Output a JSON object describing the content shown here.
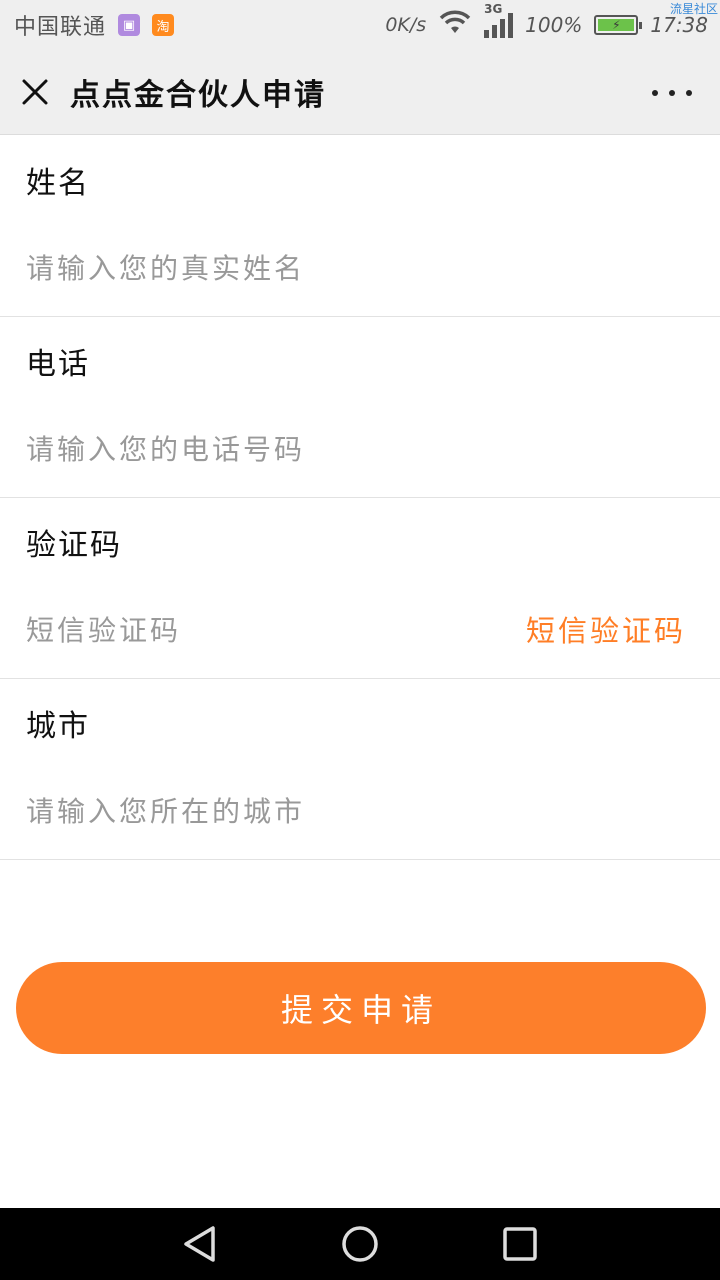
{
  "status_bar": {
    "carrier": "中国联通",
    "badge_gallery": "▣",
    "badge_taobao": "淘",
    "speed": "0K/s",
    "network": "3G",
    "battery_percent": "100%",
    "time": "17:38",
    "watermark": "流星社区"
  },
  "nav": {
    "title": "点点金合伙人申请",
    "close_icon": "close-icon",
    "more_icon": "more-dots-icon"
  },
  "form": {
    "name": {
      "label": "姓名",
      "placeholder": "请输入您的真实姓名",
      "value": ""
    },
    "phone": {
      "label": "电话",
      "placeholder": "请输入您的电话号码",
      "value": ""
    },
    "code": {
      "label": "验证码",
      "placeholder": "短信验证码",
      "value": "",
      "button": "短信验证码"
    },
    "city": {
      "label": "城市",
      "placeholder": "请输入您所在的城市",
      "value": ""
    }
  },
  "submit_label": "提交申请",
  "colors": {
    "accent": "#fd7f2b",
    "link_orange": "#ff7e26",
    "nav_bg": "#efefef",
    "system_nav_bg": "#000000"
  },
  "system_nav": {
    "back_icon": "back-triangle-icon",
    "home_icon": "home-circle-icon",
    "recents_icon": "recents-square-icon"
  }
}
